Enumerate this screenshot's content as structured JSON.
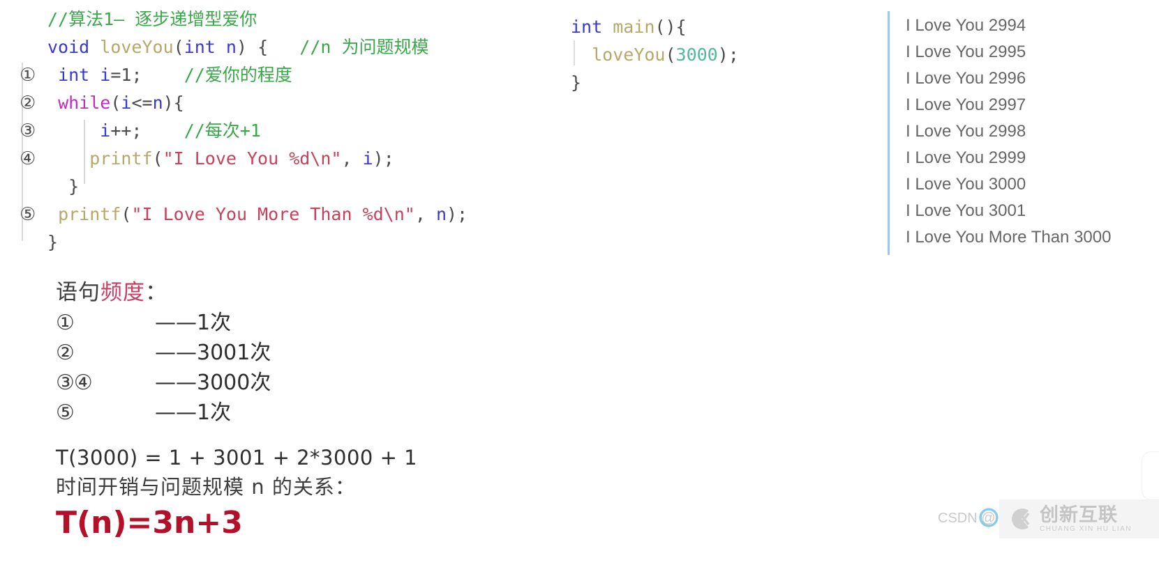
{
  "code": {
    "lines": [
      {
        "marker": "",
        "tokens": [
          {
            "t": "//算法1— 逐步递增型爱你",
            "c": "k-comment"
          }
        ]
      },
      {
        "marker": "",
        "tokens": [
          {
            "t": "void",
            "c": "k-keyword"
          },
          {
            "t": " ",
            "c": "k-plain"
          },
          {
            "t": "loveYou",
            "c": "k-fn"
          },
          {
            "t": "(",
            "c": "k-plain"
          },
          {
            "t": "int",
            "c": "k-keyword"
          },
          {
            "t": " ",
            "c": "k-plain"
          },
          {
            "t": "n",
            "c": "k-var"
          },
          {
            "t": ") {   ",
            "c": "k-plain"
          },
          {
            "t": "//n 为问题规模",
            "c": "k-comment"
          }
        ]
      },
      {
        "marker": "①",
        "tokens": [
          {
            "t": " ",
            "c": "k-plain"
          },
          {
            "t": "int",
            "c": "k-keyword"
          },
          {
            "t": " ",
            "c": "k-plain"
          },
          {
            "t": "i",
            "c": "k-var"
          },
          {
            "t": "=1;    ",
            "c": "k-plain"
          },
          {
            "t": "//爱你的程度",
            "c": "k-comment"
          }
        ]
      },
      {
        "marker": "②",
        "tokens": [
          {
            "t": " ",
            "c": "k-plain"
          },
          {
            "t": "while",
            "c": "k-while"
          },
          {
            "t": "(",
            "c": "k-plain"
          },
          {
            "t": "i",
            "c": "k-var"
          },
          {
            "t": "<=",
            "c": "k-plain"
          },
          {
            "t": "n",
            "c": "k-var"
          },
          {
            "t": "){",
            "c": "k-plain"
          }
        ]
      },
      {
        "marker": "③",
        "tokens": [
          {
            "t": "     ",
            "c": "k-plain"
          },
          {
            "t": "i",
            "c": "k-var"
          },
          {
            "t": "++;    ",
            "c": "k-plain"
          },
          {
            "t": "//每次+1",
            "c": "k-comment"
          }
        ]
      },
      {
        "marker": "④",
        "tokens": [
          {
            "t": "    ",
            "c": "k-plain"
          },
          {
            "t": "printf",
            "c": "k-fn"
          },
          {
            "t": "(",
            "c": "k-plain"
          },
          {
            "t": "\"I Love You %d\\n\"",
            "c": "k-str"
          },
          {
            "t": ", ",
            "c": "k-plain"
          },
          {
            "t": "i",
            "c": "k-var"
          },
          {
            "t": ");",
            "c": "k-plain"
          }
        ]
      },
      {
        "marker": "",
        "tokens": [
          {
            "t": "  }",
            "c": "k-plain"
          }
        ]
      },
      {
        "marker": "⑤",
        "tokens": [
          {
            "t": " ",
            "c": "k-plain"
          },
          {
            "t": "printf",
            "c": "k-fn"
          },
          {
            "t": "(",
            "c": "k-plain"
          },
          {
            "t": "\"I Love You More Than %d\\n\"",
            "c": "k-str"
          },
          {
            "t": ", ",
            "c": "k-plain"
          },
          {
            "t": "n",
            "c": "k-var"
          },
          {
            "t": ");",
            "c": "k-plain"
          }
        ]
      },
      {
        "marker": "",
        "tokens": [
          {
            "t": "}",
            "c": "k-plain"
          }
        ]
      }
    ]
  },
  "main_code": {
    "lines": [
      [
        {
          "t": "int",
          "c": "k-keyword"
        },
        {
          "t": " ",
          "c": "k-plain"
        },
        {
          "t": "main",
          "c": "k-fn"
        },
        {
          "t": "(){",
          "c": "k-plain"
        }
      ],
      [
        {
          "t": "  ",
          "c": "k-plain"
        },
        {
          "t": "loveYou",
          "c": "k-fn"
        },
        {
          "t": "(",
          "c": "k-plain"
        },
        {
          "t": "3000",
          "c": "k-num"
        },
        {
          "t": ");",
          "c": "k-plain"
        }
      ],
      [
        {
          "t": "}",
          "c": "k-plain"
        }
      ]
    ]
  },
  "console": {
    "lines": [
      "I Love You 2994",
      "I Love You 2995",
      "I Love You 2996",
      "I Love You 2997",
      "I Love You 2998",
      "I Love You 2999",
      "I Love You 3000",
      "I Love You 3001",
      "I Love You More Than 3000"
    ]
  },
  "frequency": {
    "title_prefix": "语句",
    "title_accent": "频度",
    "title_suffix": "：",
    "rows": [
      {
        "marks": "①",
        "count": "——1次"
      },
      {
        "marks": "②",
        "count": "——3001次"
      },
      {
        "marks": "③④",
        "count": "——3000次"
      },
      {
        "marks": "⑤",
        "count": "——1次"
      }
    ]
  },
  "conclusion": {
    "t3000": "T(3000) = 1 + 3001 + 2*3000 + 1",
    "relation": "时间开销与问题规模 n 的关系：",
    "formula": "T(n)=3n+3"
  },
  "watermarks": {
    "csdn": "CSDN @",
    "cx_cn": "创新互联",
    "cx_en": "CHUANG XIN HU LIAN"
  },
  "colors": {
    "comment": "#3aa84a",
    "keyword": "#3737d6",
    "function": "#b5a86a",
    "while": "#c02bc0",
    "string": "#c8415a",
    "number": "#52b79b",
    "console_bar": "#9dc6e8",
    "accent_red": "#b3102a",
    "accent_pink": "#c63f63"
  }
}
